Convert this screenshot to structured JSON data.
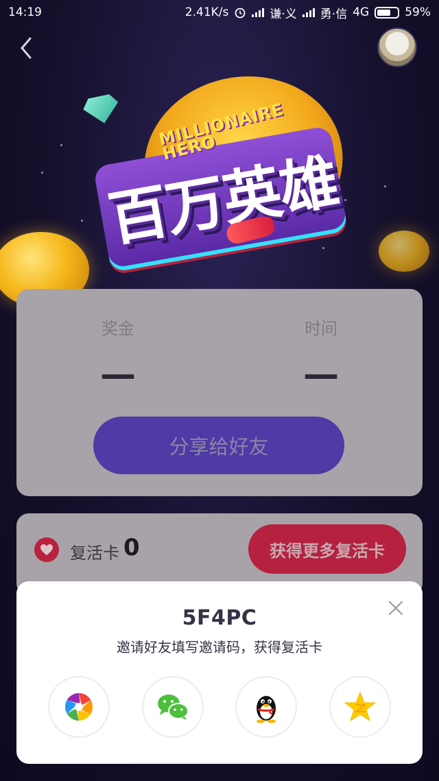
{
  "status_bar": {
    "time": "14:19",
    "speed": "2.41K/s",
    "carrier1": "谦·义",
    "carrier2": "勇·信",
    "network": "4G",
    "battery": "59%"
  },
  "header": {
    "back_icon": "chevron-left-icon",
    "avatar_icon": "dog-avatar"
  },
  "banner": {
    "logo_en_line1": "MILLIONAIRE",
    "logo_en_line2": "HERO",
    "logo_cn": "百万英雄"
  },
  "prize": {
    "bonus_label": "奖金",
    "bonus_value": "—",
    "time_label": "时间",
    "time_value": "—",
    "share_button": "分享给好友"
  },
  "revive": {
    "label": "复活卡",
    "count": "0",
    "more_button": "获得更多复活卡"
  },
  "invite": {
    "code": "5F4PC",
    "description": "邀请好友填写邀请码，获得复活卡",
    "targets": [
      {
        "name": "moments",
        "icon": "shutter-icon"
      },
      {
        "name": "wechat",
        "icon": "wechat-icon"
      },
      {
        "name": "qq",
        "icon": "qq-penguin-icon"
      },
      {
        "name": "qzone",
        "icon": "qzone-star-icon"
      }
    ]
  },
  "colors": {
    "background": "#15102b",
    "card": "#a7a3a8",
    "share_button": "#4f3aa6",
    "more_button": "#b5213f",
    "sheet": "#ffffff"
  }
}
